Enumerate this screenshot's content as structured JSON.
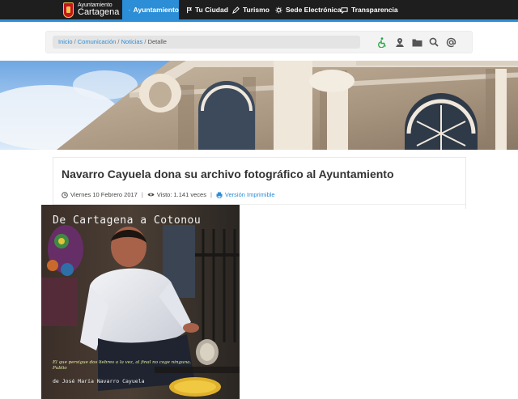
{
  "brand": {
    "line1": "Ayuntamiento",
    "line2": "Cartagena"
  },
  "nav": {
    "items": [
      {
        "label": "Ayuntamiento",
        "icon": "city-icon"
      },
      {
        "label": "Tu Ciudad",
        "icon": "signpost-icon"
      },
      {
        "label": "Turismo",
        "icon": "pencil-icon"
      },
      {
        "label": "Sede Electrónica",
        "icon": "gear-icon"
      },
      {
        "label": "Transparencia",
        "icon": "speech-bubble-icon"
      }
    ],
    "active_index": 0,
    "accent": "#2b8ed7"
  },
  "breadcrumb": {
    "items": [
      "Inicio",
      "Comunicación",
      "Noticias"
    ],
    "current": "Detalle",
    "separator": "/"
  },
  "tools": [
    "accessibility-icon",
    "map-pin-icon",
    "folder-icon",
    "search-icon",
    "at-sign-icon"
  ],
  "article": {
    "title": "Navarro Cayuela dona su archivo fotográfico al Ayuntamiento",
    "date": "Viernes 10 Febrero 2017",
    "views": "Visto: 1.141 veces",
    "print": "Versión Imprimible"
  },
  "photo": {
    "title": "De Cartagena a Cotonou",
    "quote": "El que persigue dos liebres a la vez, al final no coge ninguna.",
    "quote_source": "Publio",
    "author": "de José María Navarro Cayuela"
  }
}
